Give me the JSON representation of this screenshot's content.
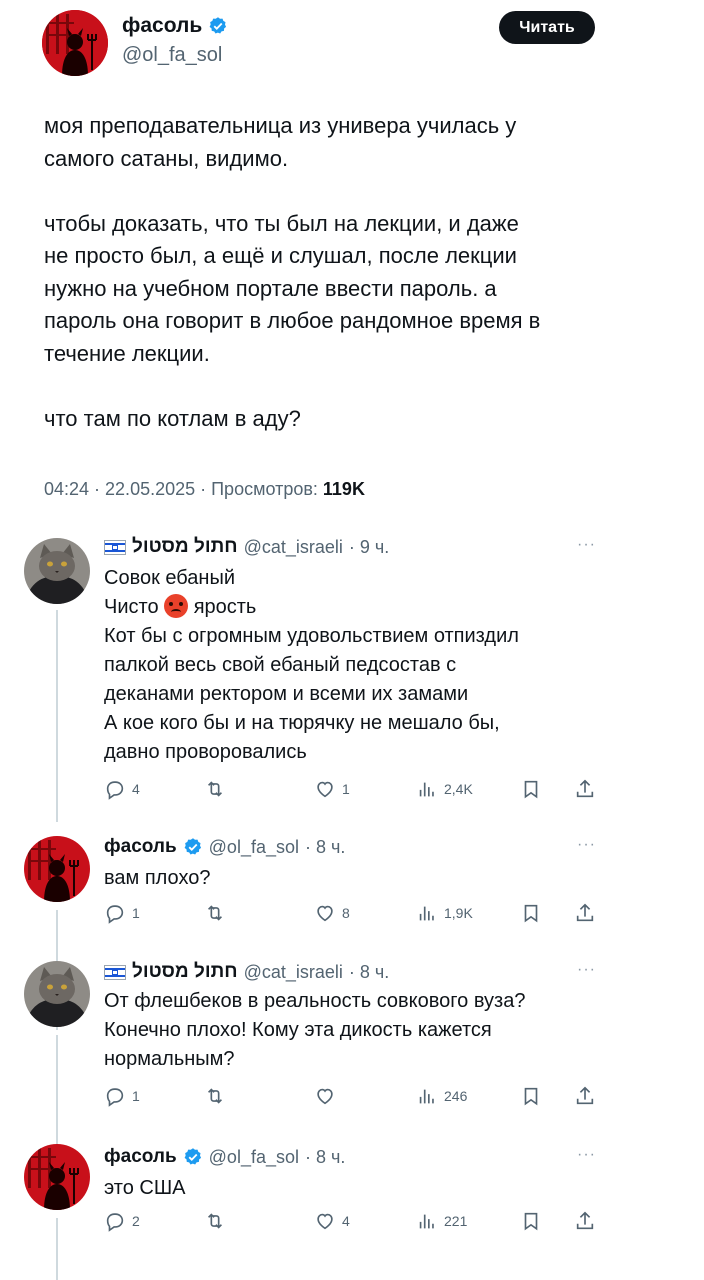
{
  "main_tweet": {
    "name": "фасоль",
    "handle": "@ol_fa_sol",
    "follow_label": "Читать",
    "paragraphs": [
      [
        "моя преподавательница из универа училась у",
        "самого сатаны, видимо."
      ],
      [
        "чтобы доказать, что ты был на лекции, и даже",
        "не просто был, а ещё и слушал, после лекции",
        "нужно на учебном портале ввести пароль. а",
        "пароль она говорит в любое рандомное время в",
        "течение лекции."
      ],
      [
        "что там по котлам в аду?"
      ]
    ],
    "meta_time": "04:24 · 22.05.2025 · Просмотров: ",
    "meta_views": "119K"
  },
  "replies": [
    {
      "name": "חתול מסטול",
      "handle": "@cat_israeli",
      "time": "· 9 ч.",
      "flag": true,
      "avatar": "cat",
      "lines": [
        "Совок ебаный",
        "Чисто",
        "ярость",
        "Кот бы с огромным удовольствием отпиздил",
        "палкой весь свой ебаный педсостав с",
        "деканами ректором и всеми их замами",
        "А кое кого бы и на тюрячку не мешало бы,",
        "давно проворовались"
      ],
      "replies": "4",
      "retweets": "",
      "likes": "1",
      "views": "2,4K"
    },
    {
      "name": "фасоль",
      "handle": "@ol_fa_sol",
      "time": "· 8 ч.",
      "flag": false,
      "avatar": "devil",
      "lines": [
        "вам плохо?"
      ],
      "replies": "1",
      "retweets": "",
      "likes": "8",
      "views": "1,9K"
    },
    {
      "name": "חתול מסטול",
      "handle": "@cat_israeli",
      "time": "· 8 ч.",
      "flag": true,
      "avatar": "cat",
      "lines": [
        "От флешбеков в реальность совкового вуза?",
        "Конечно плохо! Кому эта дикость кажется",
        "нормальным?"
      ],
      "replies": "1",
      "retweets": "",
      "likes": "",
      "views": "246"
    },
    {
      "name": "фасоль",
      "handle": "@ol_fa_sol",
      "time": "· 8 ч.",
      "flag": false,
      "avatar": "devil",
      "lines": [
        "это США"
      ],
      "replies": "2",
      "retweets": "",
      "likes": "4",
      "views": "221"
    }
  ],
  "colors": {
    "accent": "#1d9bf0",
    "text": "#0f1419",
    "muted": "#536471",
    "avatar_red": "#c8101a"
  },
  "icons": [
    "verified-badge-icon",
    "reply-icon",
    "retweet-icon",
    "like-icon",
    "views-icon",
    "bookmark-icon",
    "share-icon",
    "more-icon",
    "israel-flag-icon",
    "angry-face-emoji"
  ]
}
